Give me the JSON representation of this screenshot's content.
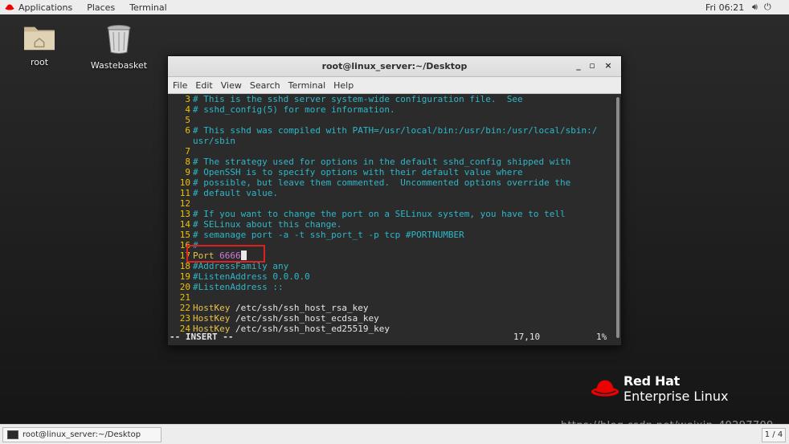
{
  "topbar": {
    "menus": [
      "Applications",
      "Places",
      "Terminal"
    ],
    "clock": "Fri 06:21"
  },
  "desktop": {
    "icons": [
      {
        "label": "root"
      },
      {
        "label": "Wastebasket"
      }
    ]
  },
  "window": {
    "title": "root@linux_server:~/Desktop",
    "menu": [
      "File",
      "Edit",
      "View",
      "Search",
      "Terminal",
      "Help"
    ]
  },
  "editor": {
    "lines": [
      {
        "n": "3",
        "text": "# This is the sshd server system-wide configuration file.  See"
      },
      {
        "n": "4",
        "text": "# sshd_config(5) for more information."
      },
      {
        "n": "5",
        "text": ""
      },
      {
        "n": "6",
        "text": "# This sshd was compiled with PATH=/usr/local/bin:/usr/bin:/usr/local/sbin:/"
      },
      {
        "n": "",
        "text": "usr/sbin"
      },
      {
        "n": "7",
        "text": ""
      },
      {
        "n": "8",
        "text": "# The strategy used for options in the default sshd_config shipped with"
      },
      {
        "n": "9",
        "text": "# OpenSSH is to specify options with their default value where"
      },
      {
        "n": "10",
        "text": "# possible, but leave them commented.  Uncommented options override the"
      },
      {
        "n": "11",
        "text": "# default value."
      },
      {
        "n": "12",
        "text": ""
      },
      {
        "n": "13",
        "text": "# If you want to change the port on a SELinux system, you have to tell"
      },
      {
        "n": "14",
        "text": "# SELinux about this change."
      },
      {
        "n": "15",
        "text": "# semanage port -a -t ssh_port_t -p tcp #PORTNUMBER"
      },
      {
        "n": "16",
        "text": "#"
      },
      {
        "n": "17",
        "kw": "Port",
        "val": "6666"
      },
      {
        "n": "18",
        "text": "#AddressFamily any"
      },
      {
        "n": "19",
        "text": "#ListenAddress 0.0.0.0"
      },
      {
        "n": "20",
        "text": "#ListenAddress ::"
      },
      {
        "n": "21",
        "text": ""
      },
      {
        "n": "22",
        "kw": "HostKey",
        "val": "/etc/ssh/ssh_host_rsa_key"
      },
      {
        "n": "23",
        "kw": "HostKey",
        "val": "/etc/ssh/ssh_host_ecdsa_key"
      },
      {
        "n": "24",
        "kw": "HostKey",
        "val": "/etc/ssh/ssh_host_ed25519_key"
      }
    ],
    "status_mode": "-- INSERT --",
    "status_pos": "17,10",
    "status_pct": "1%"
  },
  "brand": {
    "line1": "Red Hat",
    "line2": "Enterprise Linux"
  },
  "watermark": "https://blog.csdn.net/weixin_49297709",
  "taskbar": {
    "task_label": "root@linux_server:~/Desktop",
    "pager": "1 / 4"
  },
  "colors": {
    "comment": "#2eb7c8",
    "line_number": "#f0c000",
    "keyword": "#e9c24a",
    "highlight_box": "#e02020",
    "redhat_red": "#ee0000"
  }
}
